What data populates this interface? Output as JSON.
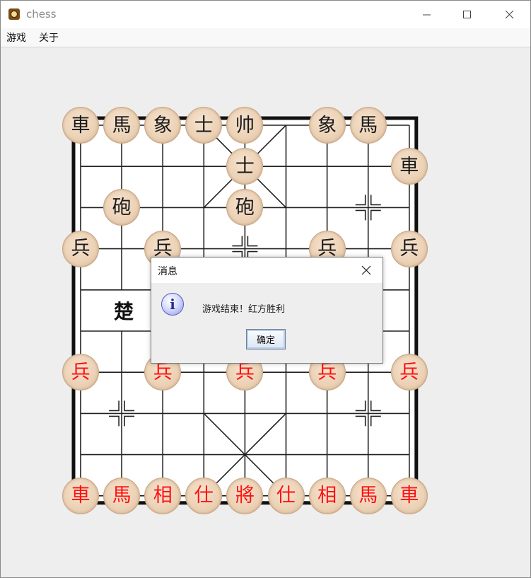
{
  "window": {
    "title": "chess",
    "icon": "chess-app-icon",
    "controls": [
      "minimize-icon",
      "maximize-icon",
      "close-icon"
    ]
  },
  "menubar": {
    "items": [
      "游戏",
      "关于"
    ]
  },
  "board": {
    "river_text": "楚",
    "pieces": [
      {
        "char": "車",
        "side": "black",
        "col": 0,
        "row": 0
      },
      {
        "char": "馬",
        "side": "black",
        "col": 1,
        "row": 0
      },
      {
        "char": "象",
        "side": "black",
        "col": 2,
        "row": 0
      },
      {
        "char": "士",
        "side": "black",
        "col": 3,
        "row": 0
      },
      {
        "char": "帅",
        "side": "black",
        "col": 4,
        "row": 0
      },
      {
        "char": "象",
        "side": "black",
        "col": 6,
        "row": 0
      },
      {
        "char": "馬",
        "side": "black",
        "col": 7,
        "row": 0
      },
      {
        "char": "士",
        "side": "black",
        "col": 4,
        "row": 1
      },
      {
        "char": "車",
        "side": "black",
        "col": 8,
        "row": 1
      },
      {
        "char": "砲",
        "side": "black",
        "col": 1,
        "row": 2
      },
      {
        "char": "砲",
        "side": "black",
        "col": 4,
        "row": 2
      },
      {
        "char": "兵",
        "side": "black",
        "col": 0,
        "row": 3
      },
      {
        "char": "兵",
        "side": "black",
        "col": 2,
        "row": 3
      },
      {
        "char": "兵",
        "side": "black",
        "col": 6,
        "row": 3
      },
      {
        "char": "兵",
        "side": "black",
        "col": 8,
        "row": 3
      },
      {
        "char": "兵",
        "side": "red",
        "col": 0,
        "row": 6
      },
      {
        "char": "兵",
        "side": "red",
        "col": 2,
        "row": 6
      },
      {
        "char": "兵",
        "side": "red",
        "col": 4,
        "row": 6
      },
      {
        "char": "兵",
        "side": "red",
        "col": 6,
        "row": 6
      },
      {
        "char": "兵",
        "side": "red",
        "col": 8,
        "row": 6
      },
      {
        "char": "車",
        "side": "red",
        "col": 0,
        "row": 9
      },
      {
        "char": "馬",
        "side": "red",
        "col": 1,
        "row": 9
      },
      {
        "char": "相",
        "side": "red",
        "col": 2,
        "row": 9
      },
      {
        "char": "仕",
        "side": "red",
        "col": 3,
        "row": 9
      },
      {
        "char": "將",
        "side": "red",
        "col": 4,
        "row": 9
      },
      {
        "char": "仕",
        "side": "red",
        "col": 5,
        "row": 9
      },
      {
        "char": "相",
        "side": "red",
        "col": 6,
        "row": 9
      },
      {
        "char": "馬",
        "side": "red",
        "col": 7,
        "row": 9
      },
      {
        "char": "車",
        "side": "red",
        "col": 8,
        "row": 9
      }
    ]
  },
  "dialog": {
    "title": "消息",
    "message": "游戏结束！红方胜利",
    "ok_label": "确定",
    "icon": "info-icon"
  },
  "colors": {
    "red_piece": "#ff1010",
    "black_piece": "#1a1a1a",
    "board_line": "#222222"
  }
}
